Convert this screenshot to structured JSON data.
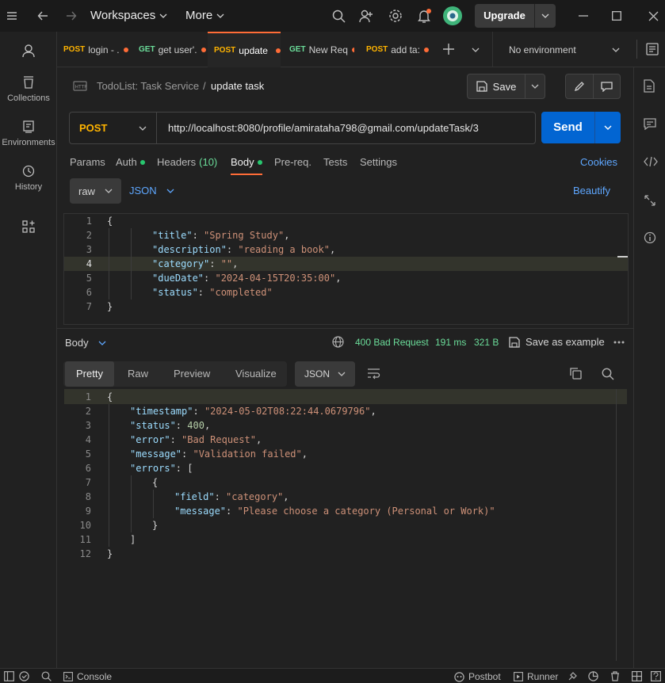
{
  "titlebar": {
    "workspaces": "Workspaces",
    "more": "More",
    "upgrade": "Upgrade"
  },
  "sidebar": {
    "items": [
      {
        "label": "Collections"
      },
      {
        "label": "Environments"
      },
      {
        "label": "History"
      }
    ]
  },
  "tabs": [
    {
      "method": "POST",
      "label": "login - ."
    },
    {
      "method": "GET",
      "label": "get user'."
    },
    {
      "method": "POST",
      "label": "update"
    },
    {
      "method": "GET",
      "label": "New Req"
    },
    {
      "method": "POST",
      "label": "add ta:"
    }
  ],
  "environment": {
    "selected": "No environment"
  },
  "breadcrumb": {
    "collection": "TodoList: Task Service",
    "separator": "/",
    "request": "update task"
  },
  "save_label": "Save",
  "request": {
    "method": "POST",
    "url": "http://localhost:8080/profile/amirataha798@gmail.com/updateTask/3",
    "send_label": "Send"
  },
  "request_tabs": {
    "params": "Params",
    "auth": "Auth",
    "headers": "Headers",
    "headers_count": "(10)",
    "body": "Body",
    "prereq": "Pre-req.",
    "tests": "Tests",
    "settings": "Settings",
    "cookies": "Cookies"
  },
  "body_options": {
    "mode": "raw",
    "language": "JSON",
    "beautify": "Beautify"
  },
  "request_body_lines": [
    {
      "n": "1",
      "open": "{"
    },
    {
      "n": "2",
      "key": "\"title\"",
      "value": "\"Spring Study\"",
      "end": ","
    },
    {
      "n": "3",
      "key": "\"description\"",
      "value": "\"reading a book\"",
      "end": ","
    },
    {
      "n": "4",
      "key": "\"category\"",
      "value": "\"\"",
      "end": ","
    },
    {
      "n": "5",
      "key": "\"dueDate\"",
      "value": "\"2024-04-15T20:35:00\"",
      "end": ","
    },
    {
      "n": "6",
      "key": "\"status\"",
      "value": "\"completed\"",
      "end": ""
    },
    {
      "n": "7",
      "open": "}"
    }
  ],
  "response": {
    "label": "Body",
    "status": "400 Bad Request",
    "time": "191 ms",
    "size": "321 B",
    "save_example": "Save as example",
    "tabs": [
      "Pretty",
      "Raw",
      "Preview",
      "Visualize"
    ],
    "format": "JSON"
  },
  "response_lines": [
    {
      "n": "1"
    },
    {
      "n": "2"
    },
    {
      "n": "3"
    },
    {
      "n": "4"
    },
    {
      "n": "5"
    },
    {
      "n": "6"
    },
    {
      "n": "7"
    },
    {
      "n": "8"
    },
    {
      "n": "9"
    },
    {
      "n": "10"
    },
    {
      "n": "11"
    },
    {
      "n": "12"
    }
  ],
  "response_body": {
    "timestamp_key": "\"timestamp\"",
    "timestamp": "\"2024-05-02T08:22:44.0679796\"",
    "status_key": "\"status\"",
    "status": "400",
    "error_key": "\"error\"",
    "error": "\"Bad Request\"",
    "message_key": "\"message\"",
    "message": "\"Validation failed\"",
    "errors_key": "\"errors\"",
    "field_key": "\"field\"",
    "field": "\"category\"",
    "inner_message_key": "\"message\"",
    "inner_message": "\"Please choose a category (Personal or Work)\""
  },
  "statusbar": {
    "console": "Console",
    "postbot": "Postbot",
    "runner": "Runner"
  },
  "colors": {
    "accent": "#ff6c37",
    "send": "#0265d2",
    "post": "#ffb400",
    "get": "#6bdd9a"
  }
}
